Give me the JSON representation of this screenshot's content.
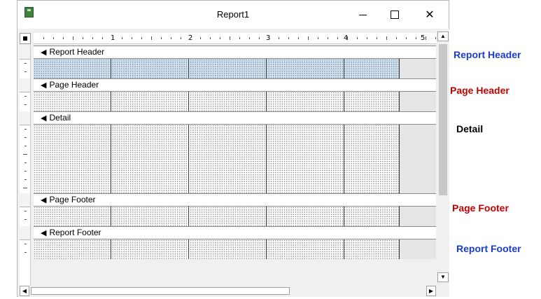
{
  "window": {
    "title": "Report1"
  },
  "ruler": {
    "numbers": [
      "1",
      "2",
      "3",
      "4",
      "5"
    ]
  },
  "sections": {
    "report_header": "Report Header",
    "page_header": "Page Header",
    "detail": "Detail",
    "page_footer": "Page Footer",
    "report_footer": "Report Footer"
  },
  "annotations": {
    "report_header": {
      "text": "Report Header",
      "color": "#1a3cc8"
    },
    "page_header": {
      "text": "Page Header",
      "color": "#c00000"
    },
    "detail": {
      "text": "Detail",
      "color": "#000000"
    },
    "page_footer": {
      "text": "Page Footer",
      "color": "#c00000"
    },
    "report_footer": {
      "text": "Report Footer",
      "color": "#1a3cc8"
    }
  },
  "icons": {
    "section_bar": "section-selector-icon",
    "minimize": "minimize-icon",
    "maximize": "maximize-icon",
    "close": "close-icon",
    "scroll_up": "scroll-up-icon",
    "scroll_down": "scroll-down-icon",
    "scroll_left": "scroll-left-icon",
    "scroll_right": "scroll-right-icon"
  },
  "colors": {
    "selected_section": "#cfe3f5"
  }
}
